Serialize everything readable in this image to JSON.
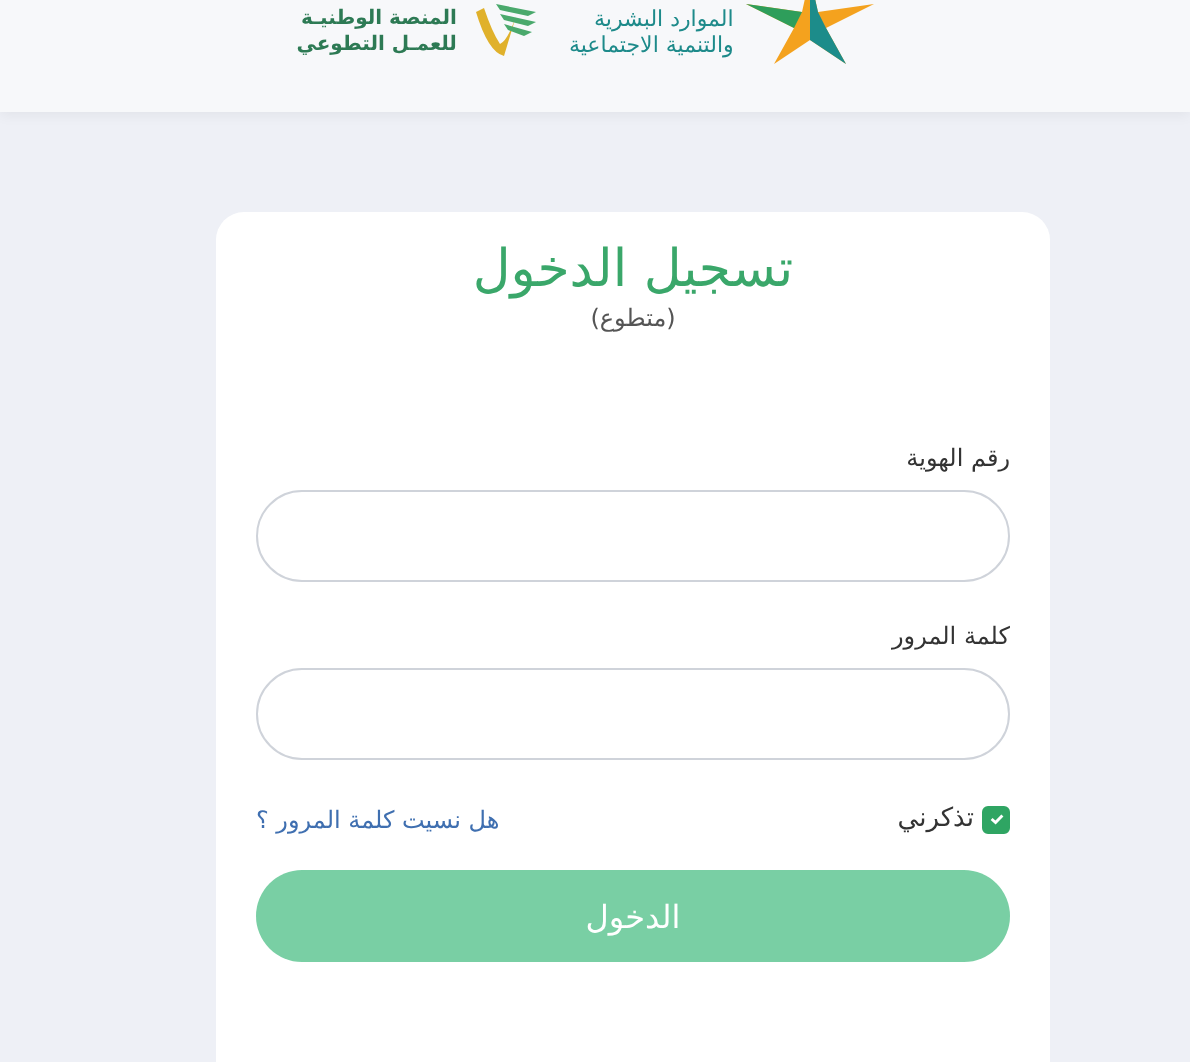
{
  "header": {
    "logos": [
      {
        "kind": "ministry",
        "lines": [
          "الموارد البشرية",
          "والتنمية الاجتماعية"
        ]
      },
      {
        "kind": "volunteer",
        "lines": [
          "المنصة الوطنيـة",
          "للعمـل التطوعي"
        ]
      }
    ]
  },
  "login": {
    "title": "تسجيل الدخول",
    "subtitle": "(متطوع)",
    "fields": [
      {
        "label": "رقم الهوية"
      },
      {
        "label": "كلمة المرور"
      }
    ],
    "remember": {
      "label": "تذكرني",
      "checked": true
    },
    "forgot_link": "هل نسيت كلمة المرور ؟",
    "submit": "الدخول"
  }
}
